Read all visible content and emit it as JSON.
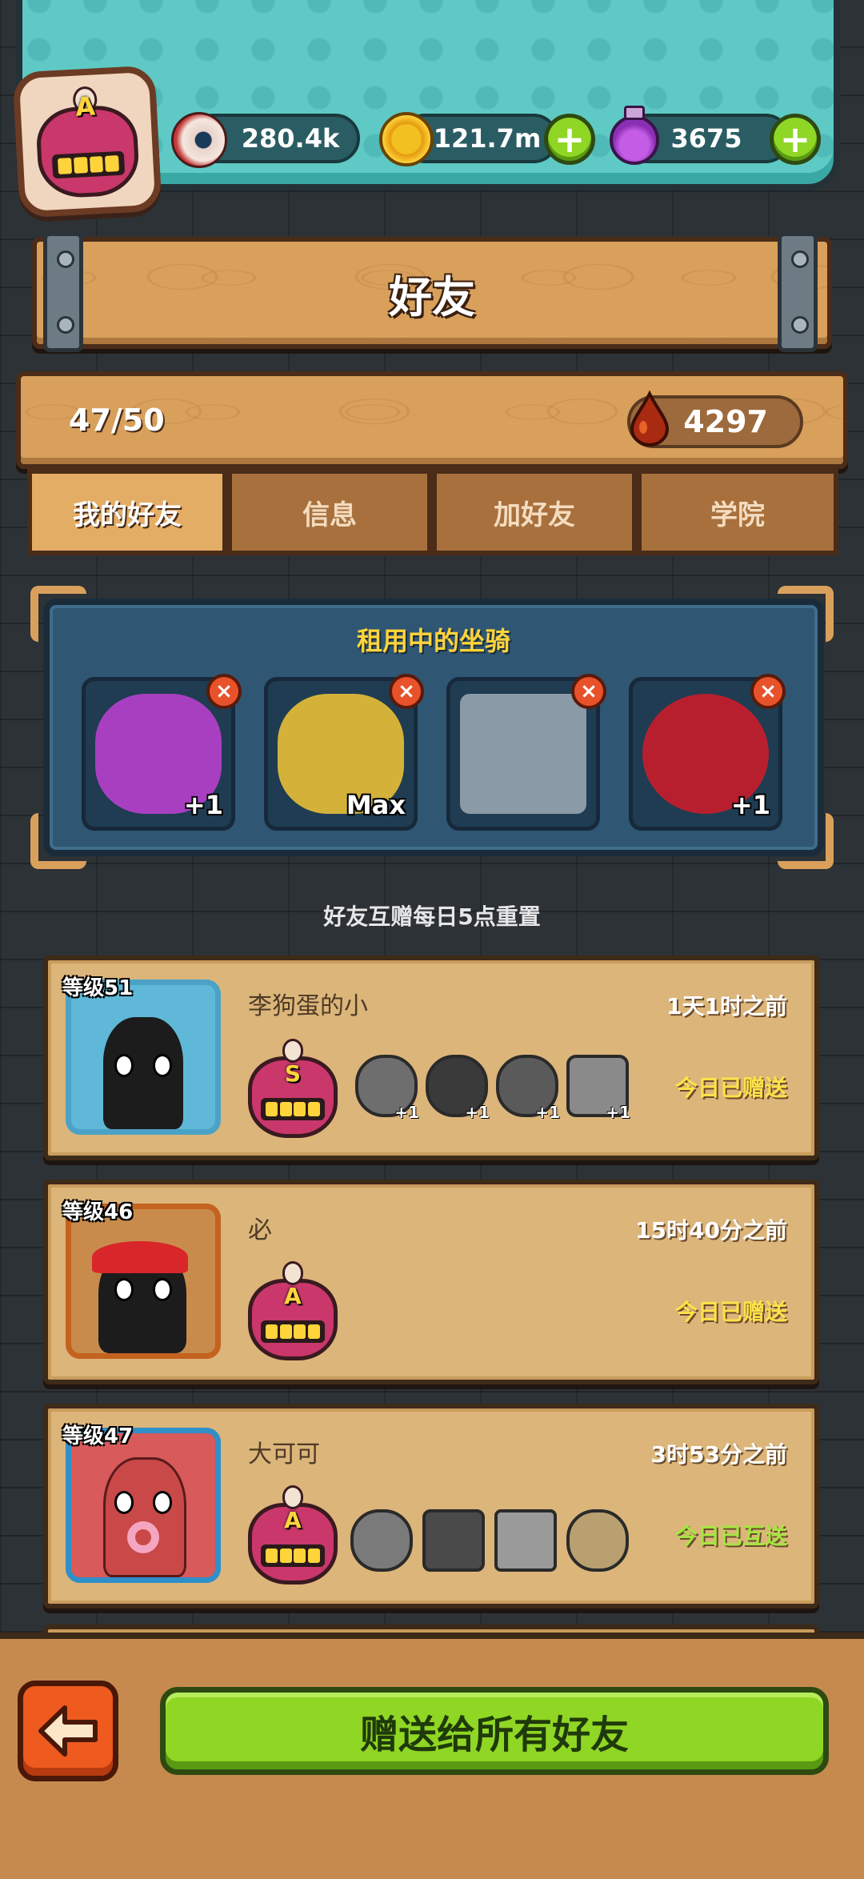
{
  "resources": {
    "eyeballs": "280.4k",
    "coins": "121.7m",
    "potions": "3675",
    "plus": "+"
  },
  "player_grade": "A",
  "header": {
    "title": "好友"
  },
  "stats": {
    "friend_count": "47/50",
    "blood_drops": "4297"
  },
  "tabs": [
    {
      "label": "我的好友",
      "active": true
    },
    {
      "label": "信息",
      "active": false
    },
    {
      "label": "加好友",
      "active": false
    },
    {
      "label": "学院",
      "active": false
    }
  ],
  "rented_mounts": {
    "title": "租用中的坐骑",
    "close_symbol": "×",
    "items": [
      {
        "icon": "purple-demon-mount-icon",
        "label": "+1",
        "color": "#a83fc0"
      },
      {
        "icon": "lion-dance-mount-icon",
        "label": "Max",
        "color": "#d4b23a"
      },
      {
        "icon": "mech-machine-mount-icon",
        "label": "",
        "color": "#8a9aa6"
      },
      {
        "icon": "red-rose-mount-icon",
        "label": "+1",
        "color": "#b81f2e"
      }
    ]
  },
  "reset_note": "好友互赠每日5点重置",
  "friends": [
    {
      "level": "等级51",
      "name": "李狗蛋的小",
      "time": "1天1时之前",
      "status": "今日已赠送",
      "badge_grade": "S",
      "mounts": [
        "+1",
        "+1",
        "+1",
        "+1"
      ],
      "frame_color": "#4aa3c6",
      "avatar_bg": "#5fb8d8"
    },
    {
      "level": "等级46",
      "name": "必",
      "time": "15时40分之前",
      "status": "今日已赠送",
      "badge_grade": "A",
      "mounts": [],
      "frame_color": "#c4621f",
      "avatar_bg": "#c98b4c"
    },
    {
      "level": "等级47",
      "name": "大可可",
      "time": "3时53分之前",
      "status": "今日已互送",
      "badge_grade": "A",
      "mounts": [
        "",
        "",
        "",
        ""
      ],
      "frame_color": "#2f8fc9",
      "avatar_bg": "#d85a5a"
    }
  ],
  "bottom": {
    "gift_all": "赠送给所有好友"
  },
  "colors": {
    "wood": "#d9a05c",
    "teal": "#5fc9c5",
    "green_button": "#8fd625",
    "orange_button": "#ef5a1f",
    "panel_blue": "#2f5673"
  }
}
